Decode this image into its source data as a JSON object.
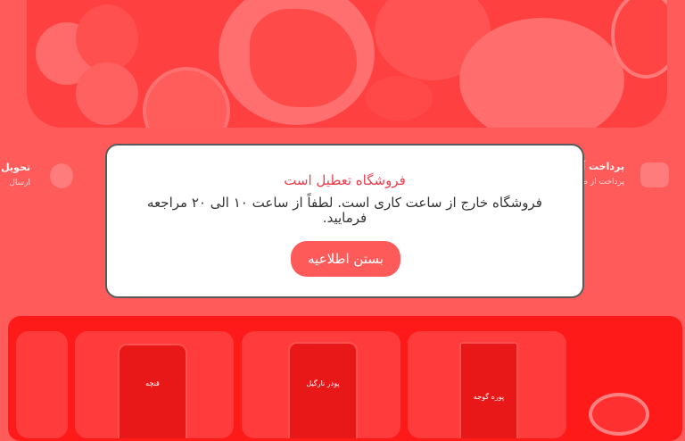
{
  "features": {
    "online_payment": {
      "title": "پرداخت آنلاین",
      "subtitle": "پرداخت از طریق درگاه بانکی"
    },
    "delivery": {
      "title": "تحویل",
      "subtitle": "ارسال"
    }
  },
  "modal": {
    "title": "فروشگاه تعطیل است",
    "message": "فروشگاه خارج از ساعت کاری است. لطفاً از ساعت ۱۰ الی ۲۰ مراجعه فرمایید.",
    "close_label": "بستن اطلاعیه"
  },
  "products": [
    {
      "label": "پوره گوجه"
    },
    {
      "label": "پودر نارگیل"
    },
    {
      "label": "قنچه"
    }
  ],
  "colors": {
    "accent": "#ff5a5a",
    "title": "#e8404f"
  }
}
